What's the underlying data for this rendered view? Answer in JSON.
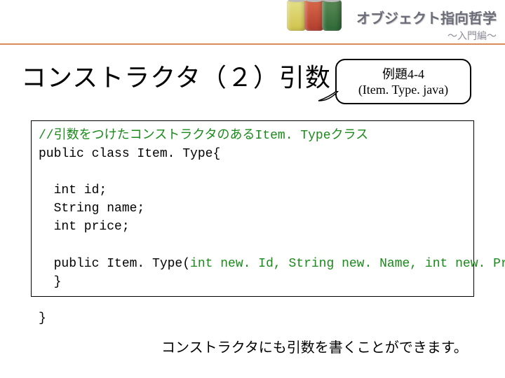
{
  "header": {
    "series_title": "オブジェクト指向哲学",
    "series_sub": "～入門編～"
  },
  "slide": {
    "title": "コンストラクタ（２）引数"
  },
  "example_box": {
    "label": "例題4-4",
    "filename": "(Item. Type. java)"
  },
  "code": {
    "comment": "//引数をつけたコンストラクタのあるItem. Typeクラス",
    "class_decl": "public class Item. Type{",
    "field1": "  int id;",
    "field2": "  String name;",
    "field3": "  int price;",
    "ctor_pre": "  public Item. Type(",
    "ctor_params": "int new. Id, String new. Name, int new. Price",
    "ctor_post": "){",
    "ctor_body": "  }",
    "class_end": "}"
  },
  "footnote": "コンストラクタにも引数を書くことができます。"
}
